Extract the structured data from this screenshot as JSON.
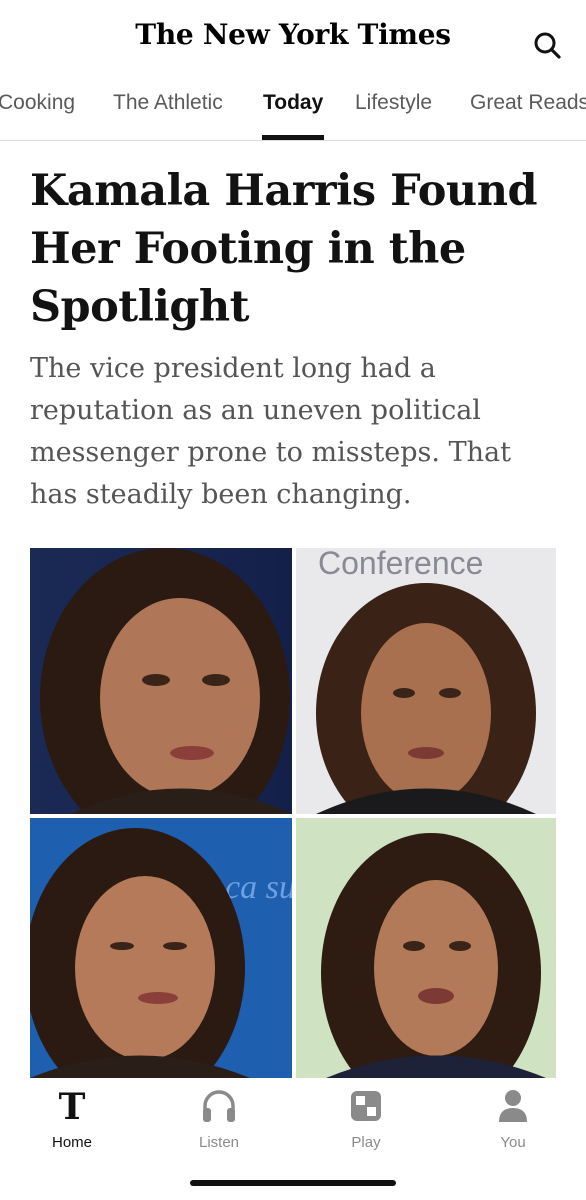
{
  "app": {
    "masthead": "The New York Times",
    "search_icon": "search-icon"
  },
  "tabs": [
    {
      "label": "Cooking",
      "active": false
    },
    {
      "label": "The Athletic",
      "active": false
    },
    {
      "label": "Today",
      "active": true
    },
    {
      "label": "Lifestyle",
      "active": false
    },
    {
      "label": "Great Reads",
      "active": false
    }
  ],
  "article": {
    "headline": "Kamala Harris Found Her Footing in the Spotlight",
    "summary": "The vice president long had a reputation as an uneven political messenger prone to missteps. That has steadily been changing.",
    "photo_text_top_right": "Conference",
    "photo_text_bottom_left": "ca su"
  },
  "bottom_nav": [
    {
      "label": "Home",
      "icon": "nyt-t-logo-icon",
      "active": true
    },
    {
      "label": "Listen",
      "icon": "headphones-icon",
      "active": false
    },
    {
      "label": "Play",
      "icon": "games-grid-icon",
      "active": false
    },
    {
      "label": "You",
      "icon": "person-icon",
      "active": false
    }
  ],
  "colors": {
    "text": "#121212",
    "muted": "#8a8a8a",
    "summary": "#555555",
    "divider": "#dcdcdc"
  }
}
